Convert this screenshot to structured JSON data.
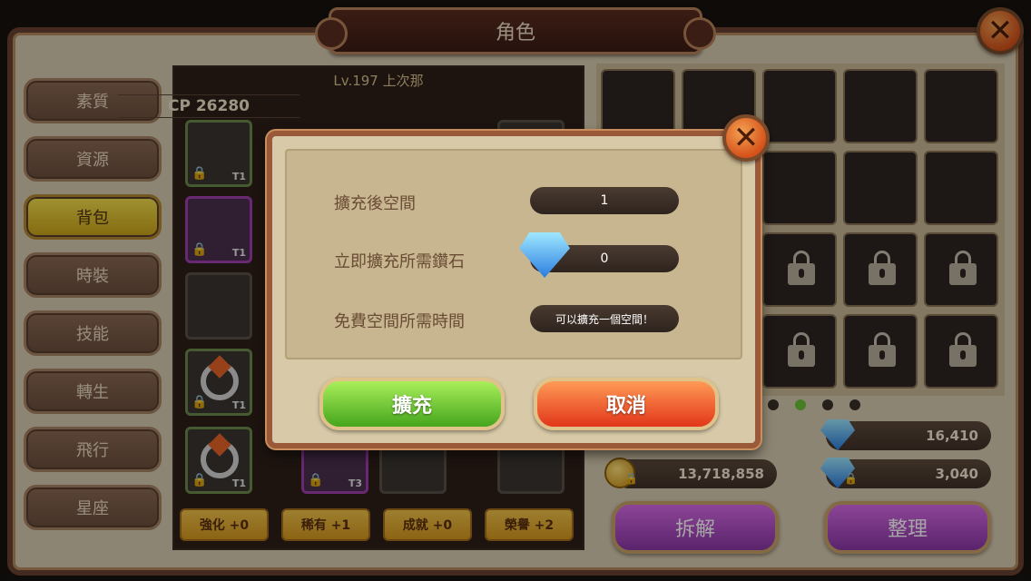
{
  "window": {
    "title": "角色"
  },
  "sidebar": {
    "items": [
      {
        "label": "素質",
        "active": false
      },
      {
        "label": "資源",
        "active": false
      },
      {
        "label": "背包",
        "active": true
      },
      {
        "label": "時裝",
        "active": false
      },
      {
        "label": "技能",
        "active": false
      },
      {
        "label": "轉生",
        "active": false
      },
      {
        "label": "飛行",
        "active": false
      },
      {
        "label": "星座",
        "active": false
      }
    ]
  },
  "character": {
    "level": "Lv.197 上次那",
    "cp": "CP 26280",
    "tier_label": "T1",
    "tier_label_3": "T3"
  },
  "stats": {
    "enhance": "強化 +0",
    "rare": "稀有 +1",
    "achievement": "成就 +0",
    "honor": "榮譽 +2"
  },
  "currency": {
    "diamond_main": "16,410",
    "gold": "13,718,858",
    "diamond_bound": "3,040"
  },
  "actions": {
    "dismantle": "拆解",
    "sort": "整理"
  },
  "dialog": {
    "rows": [
      {
        "label": "擴充後空間",
        "value": "1"
      },
      {
        "label": "立即擴充所需鑽石",
        "value": "0"
      },
      {
        "label": "免費空間所需時間",
        "value": "可以擴充一個空間！"
      }
    ],
    "confirm_label": "擴充",
    "cancel_label": "取消"
  },
  "colors": {
    "accent_green": "#6ac23a",
    "button_purple": "#b24ec8",
    "confirm_green": "#6fd12f",
    "cancel_red": "#f05a2a"
  }
}
